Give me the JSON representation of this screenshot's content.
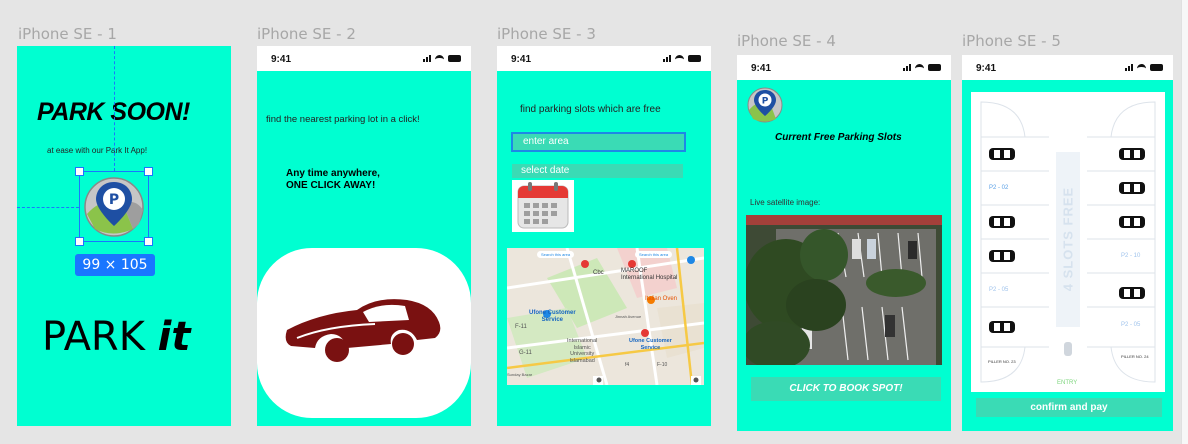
{
  "frames": [
    {
      "label": "iPhone SE - 1"
    },
    {
      "label": "iPhone SE - 2"
    },
    {
      "label": "iPhone SE - 3"
    },
    {
      "label": "iPhone SE - 4"
    },
    {
      "label": "iPhone SE - 5"
    }
  ],
  "status_time": "9:41",
  "screen1": {
    "headline": "PARK SOON!",
    "tagline": "at ease with our Park It App!",
    "logo_letter": "P",
    "selection_size": "99 × 105",
    "brand_regular": "PARK",
    "brand_bold": "it"
  },
  "screen2": {
    "intro": "find the nearest parking lot in a click!",
    "slogan_line1": "Any time anywhere,",
    "slogan_line2": "ONE CLICK AWAY!"
  },
  "screen3": {
    "intro": "find parking slots which are free",
    "area_placeholder": "enter area",
    "date_placeholder": "select date",
    "map_labels": {
      "search_area_1": "Search this area",
      "search_area_2": "Search this area",
      "cbc": "Cbc",
      "maroof_1": "MAROOF",
      "maroof_2": "International Hospital",
      "italian_oven": "Italian Oven",
      "ufone_1": "Ufone Customer",
      "ufone_1b": "Service",
      "f11": "F-11",
      "g11": "G-11",
      "intl_1": "International",
      "intl_2": "Islamic",
      "intl_3": "University",
      "intl_4": "Islamabad",
      "ufone_2": "Ufone Customer",
      "ufone_2b": "Service",
      "road_1": "Sunday Bazar",
      "road_2": "Jinnah Avenue",
      "f10": "F-10",
      "f4": "f4"
    }
  },
  "screen4": {
    "title": "Current Free Parking Slots",
    "live_label": "Live satellite image:",
    "book_button": "CLICK TO BOOK SPOT!"
  },
  "screen5": {
    "free_banner": "4 SLOTS FREE",
    "slots": [
      "P2 - 02",
      "P2 - 05",
      "P2 - 10",
      "P2 - 05"
    ],
    "pillar_left": "PILLER NO. 23",
    "pillar_right": "PILLER NO. 24",
    "entry": "ENTRY",
    "confirm_button": "confirm and pay"
  },
  "colors": {
    "screen_bg": "#00ffd1",
    "accent_blue": "#1e88e5",
    "selection_blue": "#1976ff",
    "button_teal": "#3adbb5",
    "car_red": "#7a1111"
  },
  "icons": [
    "park-it-logo-icon",
    "calendar-icon",
    "car-illustration-icon",
    "car-top-icon",
    "signal-icon",
    "wifi-icon",
    "battery-icon"
  ]
}
